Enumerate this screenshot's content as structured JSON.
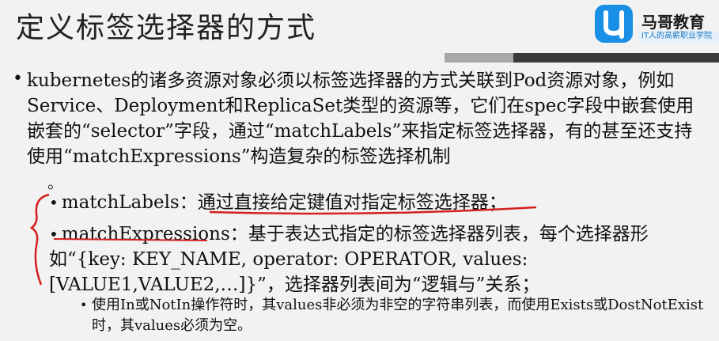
{
  "title": "定义标签选择器的方式",
  "logo": {
    "name": "马哥教育",
    "tagline": "IT人的高薪职业学院"
  },
  "main_paragraph": "kubernetes的诸多资源对象必须以标签选择器的方式关联到Pod资源对象，例如Service、Deployment和ReplicaSet类型的资源等，它们在spec字段中嵌套使用嵌套的“selector”字段，通过“matchLabels”来指定标签选择器，有的甚至还支持使用“matchExpressions”构造复杂的标签选择机制",
  "trailing_mark": "。",
  "sub_items": {
    "match_labels_term": "matchLabels",
    "match_labels_desc": "：通过直接给定键值对指定标签选择器；",
    "match_expressions_term": "matchExpressions",
    "match_expressions_desc": "：基于表达式指定的标签选择器列表，每个选择器形如“{key: KEY_NAME, operator: OPERATOR, values: [VALUE1,VALUE2,…]}”，选择器列表间为“逻辑与”关系；",
    "nested_note": "使用In或NotIn操作符时，其values非必须为非空的字符串列表，而使用Exists或DostNotExist时，其values必须为空。"
  }
}
